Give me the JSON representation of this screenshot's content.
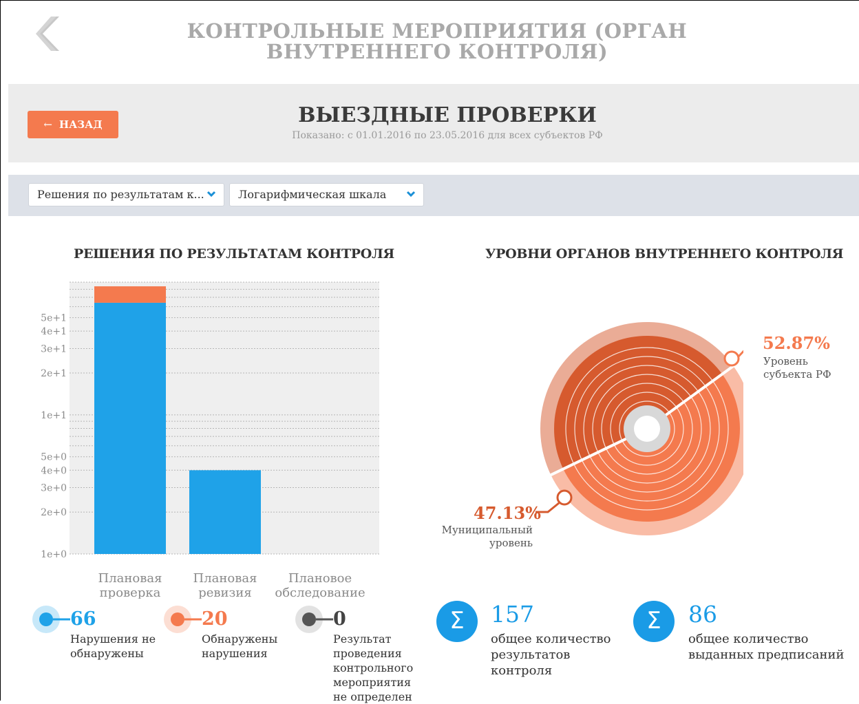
{
  "top_title": "КОНТРОЛЬНЫЕ МЕРОПРИЯТИЯ (ОРГАН ВНУТРЕННЕГО КОНТРОЛЯ)",
  "header": {
    "back_label": "НАЗАД",
    "title": "ВЫЕЗДНЫЕ ПРОВЕРКИ",
    "subtitle": "Показано: с 01.01.2016 по 23.05.2016 для всех субъектов РФ"
  },
  "filters": {
    "metric_select": "Решения по результатам к...",
    "scale_select": "Логарифмическая шкала"
  },
  "colors": {
    "blue": "#1fa2e8",
    "orange": "#f47a4e",
    "dark_orange": "#d65a2e",
    "gray": "#8a8a8a"
  },
  "chart_data": [
    {
      "type": "bar",
      "title": "РЕШЕНИЯ ПО РЕЗУЛЬТАТАМ КОНТРОЛЯ",
      "stacked": true,
      "scale": "log",
      "ylim": [
        1,
        90
      ],
      "y_ticks": [
        1,
        2,
        3,
        4,
        5,
        10,
        20,
        30,
        40,
        50
      ],
      "y_tick_labels": [
        "1e+0",
        "2e+0",
        "3e+0",
        "4e+0",
        "5e+0",
        "1e+1",
        "2e+1",
        "3e+1",
        "4e+1",
        "5e+1"
      ],
      "categories": [
        "Плановая проверка",
        "Плановая ревизия",
        "Плановое обследование"
      ],
      "series": [
        {
          "name": "Нарушения не обнаружены",
          "values": [
            63,
            3,
            0
          ],
          "color": "#1fa2e8"
        },
        {
          "name": "Обнаружены нарушения",
          "values": [
            20,
            0,
            0
          ],
          "color": "#f47a4e"
        },
        {
          "name": "Результат проведения контрольного мероприятия не определен",
          "values": [
            0,
            0,
            0
          ],
          "color": "#8a8a8a"
        }
      ],
      "grid": true
    },
    {
      "type": "pie",
      "title": "УРОВНИ ОРГАНОВ ВНУТРЕННЕГО КОНТРОЛЯ",
      "slices": [
        {
          "label": "Уровень субъекта РФ",
          "value": 52.87,
          "value_label": "52.87%",
          "color": "#f47a4e"
        },
        {
          "label": "Муниципальный уровень",
          "value": 47.13,
          "value_label": "47.13%",
          "color": "#d65a2e"
        }
      ]
    }
  ],
  "legend": [
    {
      "value": "66",
      "label": "Нарушения не обнаружены"
    },
    {
      "value": "20",
      "label": "Обнаружены нарушения"
    },
    {
      "value": "0",
      "label": "Результат проведения контрольного мероприятия не определен"
    }
  ],
  "totals": [
    {
      "value": "157",
      "label": "общее количество результатов контроля"
    },
    {
      "value": "86",
      "label": "общее количество выданных предписаний"
    }
  ]
}
